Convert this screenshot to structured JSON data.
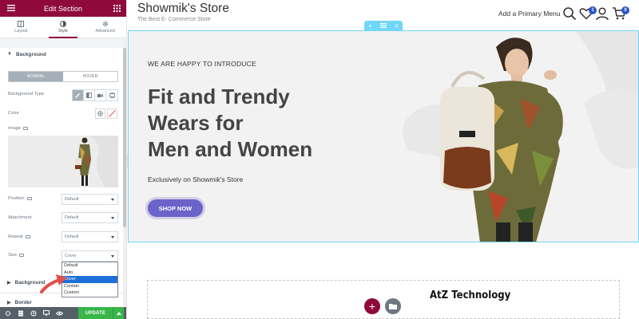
{
  "panel": {
    "title": "Edit Section",
    "tabs": [
      {
        "label": "Layout",
        "icon": "layout-icon"
      },
      {
        "label": "Style",
        "icon": "style-icon"
      },
      {
        "label": "Advanced",
        "icon": "gear-icon"
      }
    ],
    "background_section": {
      "title": "Background",
      "toggle": [
        "NORMAL",
        "HOVER"
      ],
      "background_type_label": "Background Type",
      "background_type_options": [
        "classic-brush-icon",
        "gradient-icon",
        "video-icon",
        "slideshow-icon"
      ],
      "color_label": "Color",
      "image_label": "Image",
      "position_label": "Position",
      "position_value": "Default",
      "attachment_label": "Attachment",
      "attachment_value": "Default",
      "repeat_label": "Repeat",
      "repeat_value": "Default",
      "size_label": "Size",
      "size_value": "Cover",
      "size_options": [
        "Default",
        "Auto",
        "Cover",
        "Contain",
        "Custom"
      ],
      "size_selected_index": 2
    },
    "background_overlay_title": "Background",
    "border_title": "Border",
    "footer": {
      "update_label": "UPDATE"
    }
  },
  "site": {
    "title": "Showmik's Store",
    "tagline": "The Best E- Commerce Store",
    "menu_label": "Add a Primary Menu",
    "wishlist_count": "1",
    "cart_count": "0"
  },
  "hero": {
    "intro": "WE ARE HAPPY TO INTRODUCE",
    "heading_lines": [
      "Fit and Trendy",
      "Wears for",
      "Men and Women"
    ],
    "subtext": "Exclusively on Showmik's Store",
    "button_label": "SHOP NOW"
  },
  "watermark": "AtZ Technology",
  "colors": {
    "brand": "#8f0a3a",
    "accent": "#6c63c9",
    "editor_outline": "#71d7f7",
    "update_green": "#39b54a"
  }
}
